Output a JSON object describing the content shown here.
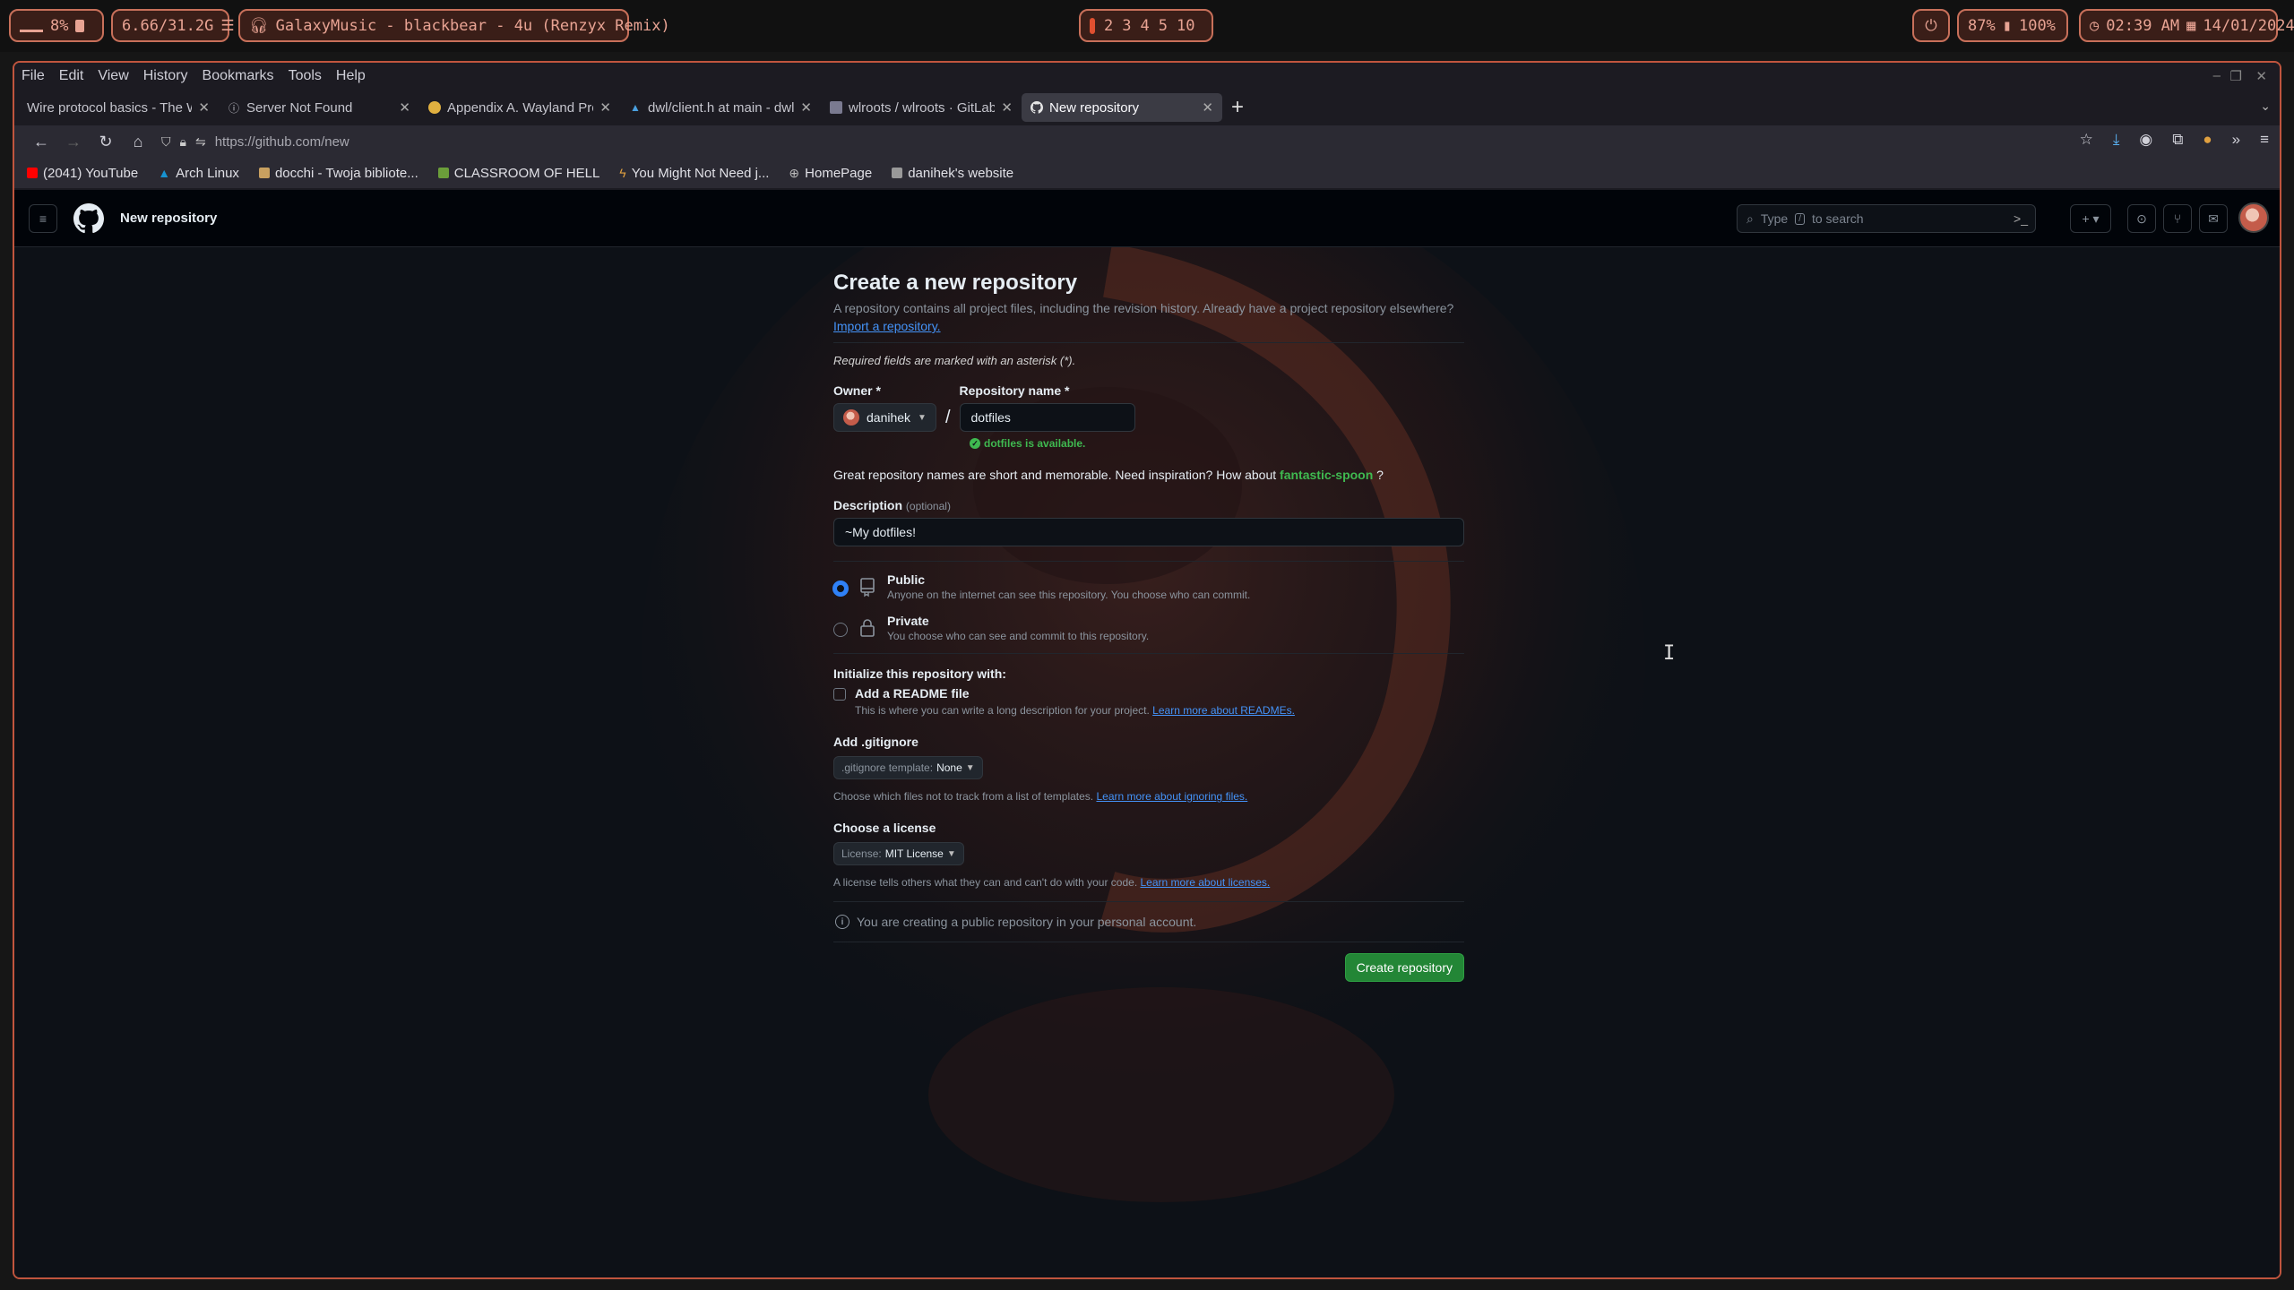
{
  "statusbar": {
    "cpu": "8%",
    "memory": "6.66/31.2G",
    "music": "GalaxyMusic - blackbear - 4u (Renzyx Remix)",
    "workspaces": [
      "2",
      "3",
      "4",
      "5",
      "10"
    ],
    "battery_a": "87%",
    "battery_b": "100%",
    "time": "02:39 AM",
    "date": "14/01/2024"
  },
  "browser": {
    "menu": [
      "File",
      "Edit",
      "View",
      "History",
      "Bookmarks",
      "Tools",
      "Help"
    ],
    "tabs": [
      {
        "label": "Wire protocol basics - The W",
        "active": false,
        "icon": "page-icon"
      },
      {
        "label": "Server Not Found",
        "active": false,
        "icon": "info-icon"
      },
      {
        "label": "Appendix A. Wayland Pro",
        "active": false,
        "icon": "wayland-icon"
      },
      {
        "label": "dwl/client.h at main - dwl",
        "active": false,
        "icon": "codeberg-icon"
      },
      {
        "label": "wlroots / wlroots · GitLab",
        "active": false,
        "icon": "gitlab-icon"
      },
      {
        "label": "New repository",
        "active": true,
        "icon": "github-icon"
      }
    ],
    "url": "https://github.com/new",
    "bookmarks": [
      {
        "label": "(2041) YouTube",
        "color": "#ff0000"
      },
      {
        "label": "Arch Linux",
        "color": "#1793d1"
      },
      {
        "label": "docchi - Twoja bibliote...",
        "color": "#c8a060"
      },
      {
        "label": "CLASSROOM OF HELL",
        "color": "#6b9e3a"
      },
      {
        "label": "You Might Not Need j...",
        "color": "#e0a040"
      },
      {
        "label": "HomePage",
        "color": "#bbbbbb"
      },
      {
        "label": "danihek's website",
        "color": "#999999"
      }
    ]
  },
  "github": {
    "context": "New repository",
    "search_placeholder_pre": "Type",
    "search_key": "/",
    "search_placeholder_post": "to search",
    "title": "Create a new repository",
    "lead": "A repository contains all project files, including the revision history. Already have a project repository elsewhere?",
    "import_link": "Import a repository.",
    "required_note": "Required fields are marked with an asterisk (*).",
    "owner_label": "Owner *",
    "owner_value": "danihek",
    "repo_label": "Repository name *",
    "repo_value": "dotfiles",
    "available": "dotfiles is available.",
    "hint_pre": "Great repository names are short and memorable. Need inspiration? How about",
    "hint_suggestion": "fantastic-spoon",
    "hint_post": "?",
    "description_label": "Description",
    "description_optional": "(optional)",
    "description_value": "~My dotfiles!",
    "public_title": "Public",
    "public_desc": "Anyone on the internet can see this repository. You choose who can commit.",
    "private_title": "Private",
    "private_desc": "You choose who can see and commit to this repository.",
    "init_label": "Initialize this repository with:",
    "readme_title": "Add a README file",
    "readme_desc": "This is where you can write a long description for your project.",
    "readme_link": "Learn more about READMEs.",
    "gitignore_label": "Add .gitignore",
    "gitignore_btn_pre": ".gitignore template:",
    "gitignore_btn_value": "None",
    "gitignore_desc": "Choose which files not to track from a list of templates.",
    "gitignore_link": "Learn more about ignoring files.",
    "license_label": "Choose a license",
    "license_btn_pre": "License:",
    "license_btn_value": "MIT License",
    "license_desc": "A license tells others what they can and can't do with your code.",
    "license_link": "Learn more about licenses.",
    "info_text": "You are creating a public repository in your personal account.",
    "create_button": "Create repository"
  }
}
